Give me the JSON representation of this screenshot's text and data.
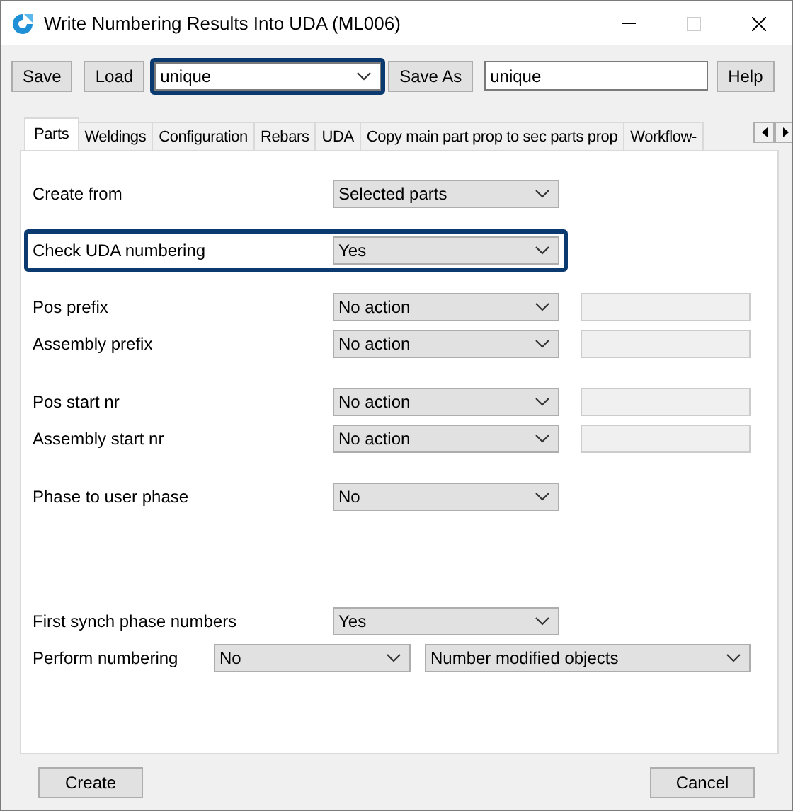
{
  "window": {
    "title": "Write Numbering Results Into UDA (ML006)",
    "maximize_disabled": true
  },
  "toolbar": {
    "save": "Save",
    "load": "Load",
    "preset": {
      "value": "unique",
      "highlighted": true
    },
    "save_as": "Save As",
    "save_as_name": "unique",
    "help": "Help"
  },
  "tabs": [
    {
      "label": "Parts",
      "selected": true
    },
    {
      "label": "Weldings",
      "selected": false
    },
    {
      "label": "Configuration",
      "selected": false
    },
    {
      "label": "Rebars",
      "selected": false
    },
    {
      "label": "UDA",
      "selected": false
    },
    {
      "label": "Copy main part prop to sec parts prop",
      "selected": false
    },
    {
      "label": "Workflow-",
      "selected": false
    }
  ],
  "groups": [
    {
      "highlighted": false,
      "rows": [
        {
          "kind": "select",
          "label": "Create from",
          "value": "Selected parts"
        }
      ]
    },
    {
      "highlighted": true,
      "rows": [
        {
          "kind": "select",
          "label": "Check UDA numbering",
          "value": "Yes"
        }
      ]
    },
    {
      "highlighted": false,
      "rows": [
        {
          "kind": "select-field",
          "label": "Pos prefix",
          "value": "No action",
          "field_disabled": true
        },
        {
          "kind": "select-field",
          "label": "Assembly prefix",
          "value": "No action",
          "field_disabled": true
        }
      ]
    },
    {
      "highlighted": false,
      "rows": [
        {
          "kind": "select-field",
          "label": "Pos start nr",
          "value": "No action",
          "field_disabled": true
        },
        {
          "kind": "select-field",
          "label": "Assembly start nr",
          "value": "No action",
          "field_disabled": true
        }
      ]
    },
    {
      "highlighted": false,
      "rows": [
        {
          "kind": "select",
          "label": "Phase to user phase",
          "value": "No"
        }
      ]
    },
    {
      "highlighted": false,
      "rows": [
        {
          "kind": "select",
          "label": "First synch phase numbers",
          "value": "Yes"
        },
        {
          "kind": "double",
          "label": "Perform numbering",
          "value": "No",
          "value_2": "Number modified objects"
        }
      ]
    }
  ],
  "footer": {
    "create": "Create",
    "cancel": "Cancel"
  }
}
